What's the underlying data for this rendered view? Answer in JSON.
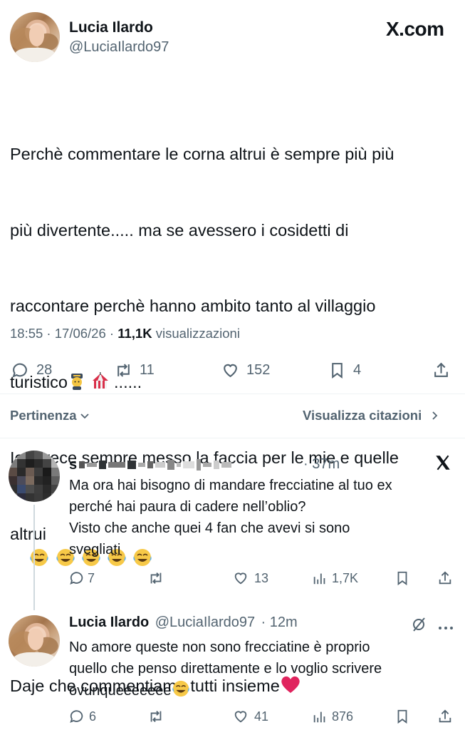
{
  "tweet": {
    "author_name": "Lucia Ilardo",
    "handle": "@LuciaIlardo97",
    "brand": "X.com",
    "lines": [
      "Perchè commentare le corna altrui è sempre più più",
      "più divertente..... ma se avessero i cosidetti di",
      "raccontare perchè hanno ambito tanto al villaggio",
      "turistico",
      "......",
      "Io invece sempre messo la faccia per le mie e quelle",
      "altrui",
      "Daje che commentiamo tutti insieme"
    ],
    "time": "18:55 · 17/06/26 · ",
    "views_count": "11,1K",
    "views_label": " visualizzazioni",
    "stats": {
      "replies": "28",
      "reposts": "11",
      "likes": "152",
      "bookmarks": "4"
    }
  },
  "sort": {
    "left": "Pertinenza",
    "right": "Visualizza citazioni"
  },
  "replies": [
    {
      "name_visible_start": "s",
      "time": "· 37m",
      "lines": [
        "Ma ora hai bisogno di mandare frecciatine al tuo ex",
        "perché hai paura di cadere nell’oblio?",
        "Visto che anche quei 4 fan che avevi si sono",
        "svegliati"
      ],
      "stats": {
        "replies": "7",
        "reposts": "",
        "likes": "13",
        "views": "1,7K"
      }
    },
    {
      "name": "Lucia Ilardo",
      "handle": "@LuciaIlardo97",
      "time": "· 12m",
      "lines": [
        "No amore queste non sono frecciatine è proprio",
        "quello che penso direttamente e lo voglio scrivere",
        "ovunqueeeeeee"
      ],
      "stats": {
        "replies": "6",
        "reposts": "",
        "likes": "41",
        "views": "876"
      }
    }
  ],
  "icons": {
    "reply": "speech-bubble-icon",
    "repost": "repost-arrows-icon",
    "like": "heart-icon",
    "bookmark": "bookmark-icon",
    "share": "share-upload-icon",
    "views": "bar-chart-icon",
    "more": "more-dots-icon",
    "grok": "grok-slash-icon",
    "x_logo": "x-logo-icon"
  },
  "colors": {
    "text": "#0f1419",
    "secondary": "#536471",
    "divider": "#eff3f4",
    "heart_emoji": "#e0245e"
  }
}
